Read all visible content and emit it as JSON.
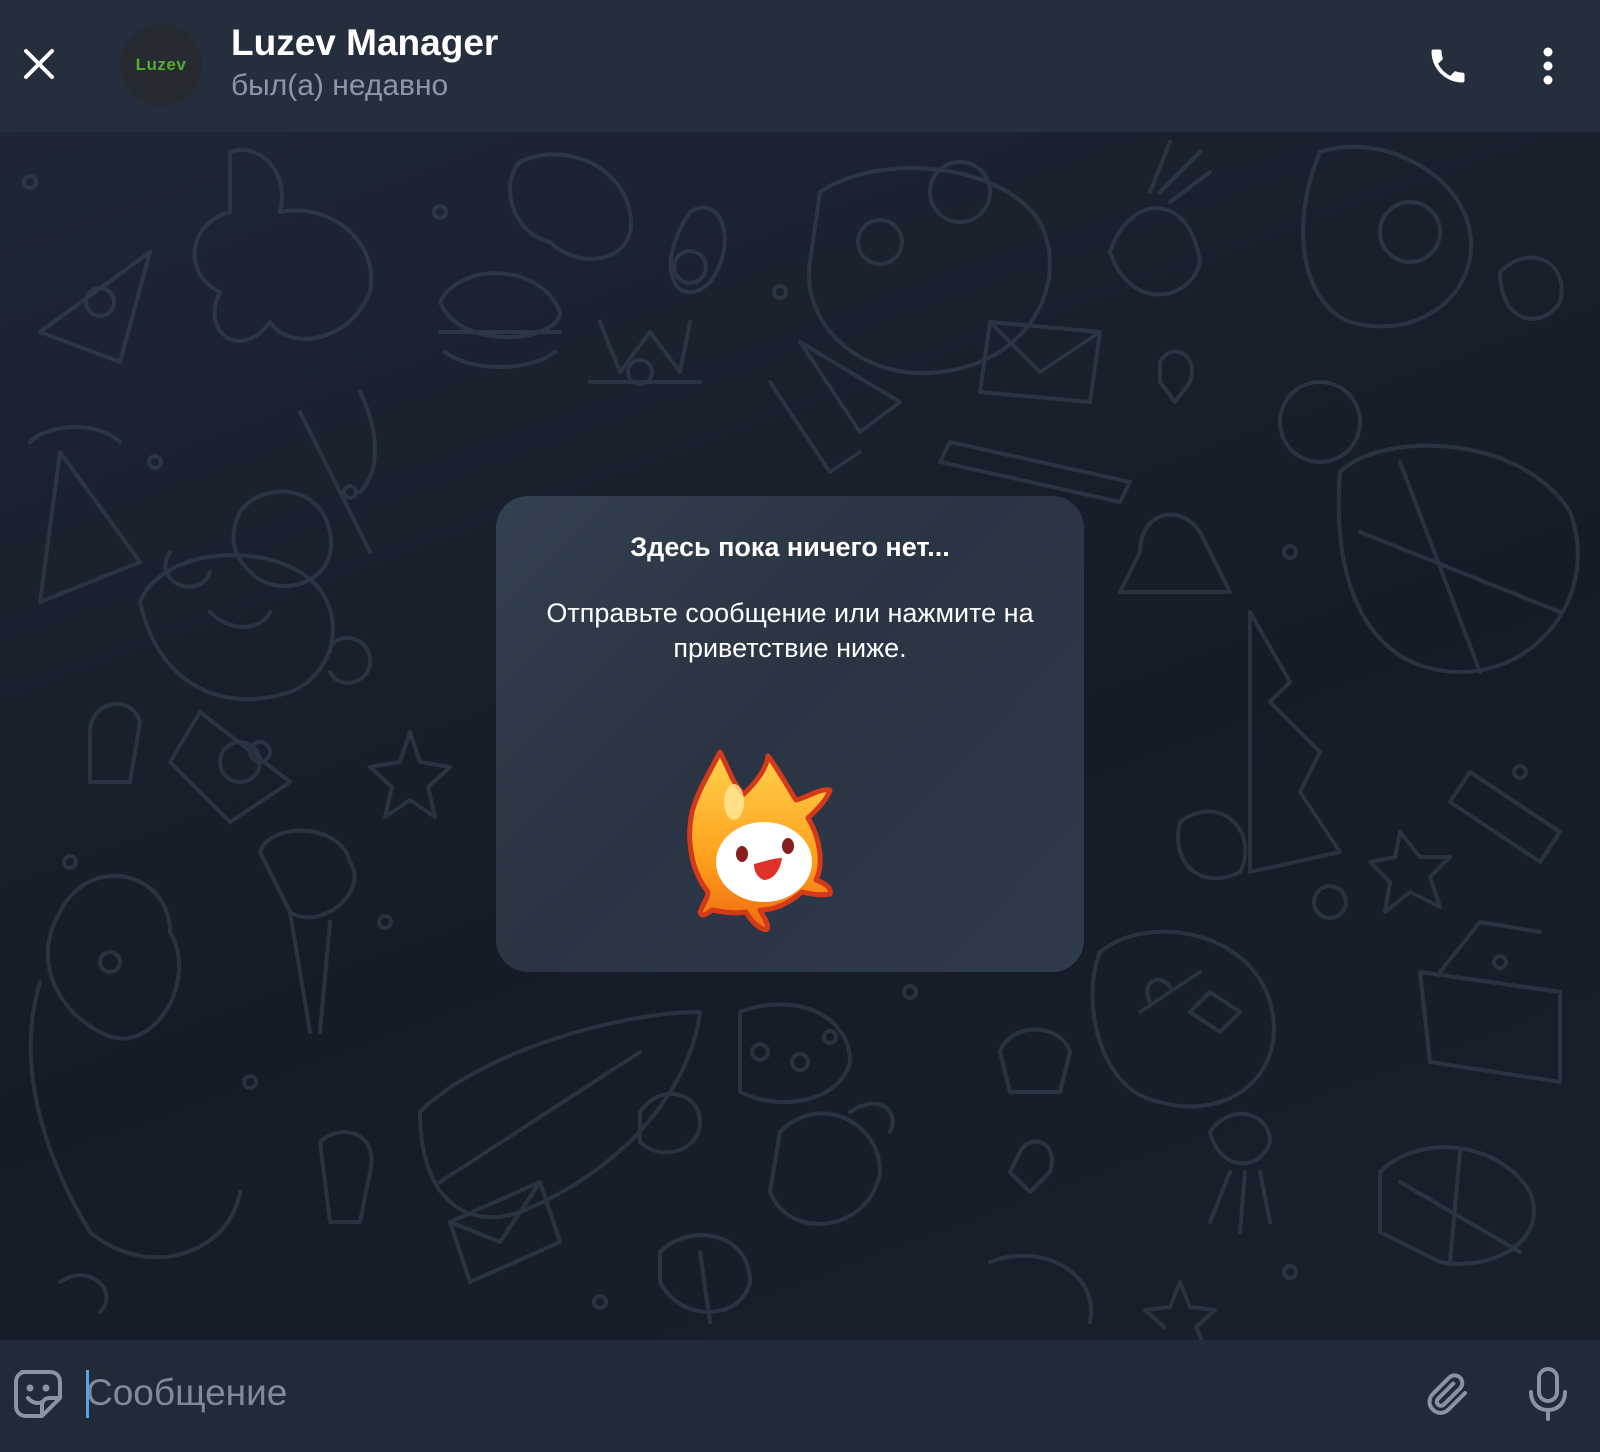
{
  "header": {
    "avatar_text": "Luzev",
    "title": "Luzev Manager",
    "status": "был(а) недавно"
  },
  "empty_state": {
    "title": "Здесь пока ничего нет...",
    "body": "Отправьте сообщение или нажмите на приветствие ниже."
  },
  "composer": {
    "placeholder": "Сообщение",
    "value": ""
  },
  "icons": {
    "close": "close-icon",
    "call": "phone-icon",
    "more": "more-vertical-icon",
    "emoji": "sticker-emoji-icon",
    "attach": "paperclip-icon",
    "mic": "microphone-icon"
  },
  "colors": {
    "header_bg": "#252e3d",
    "chat_bg": "#1b2430",
    "card_bg": "#2d3746",
    "avatar_text": "#59a935",
    "status_text": "#8b98a9",
    "caret": "#5aa2e8"
  }
}
